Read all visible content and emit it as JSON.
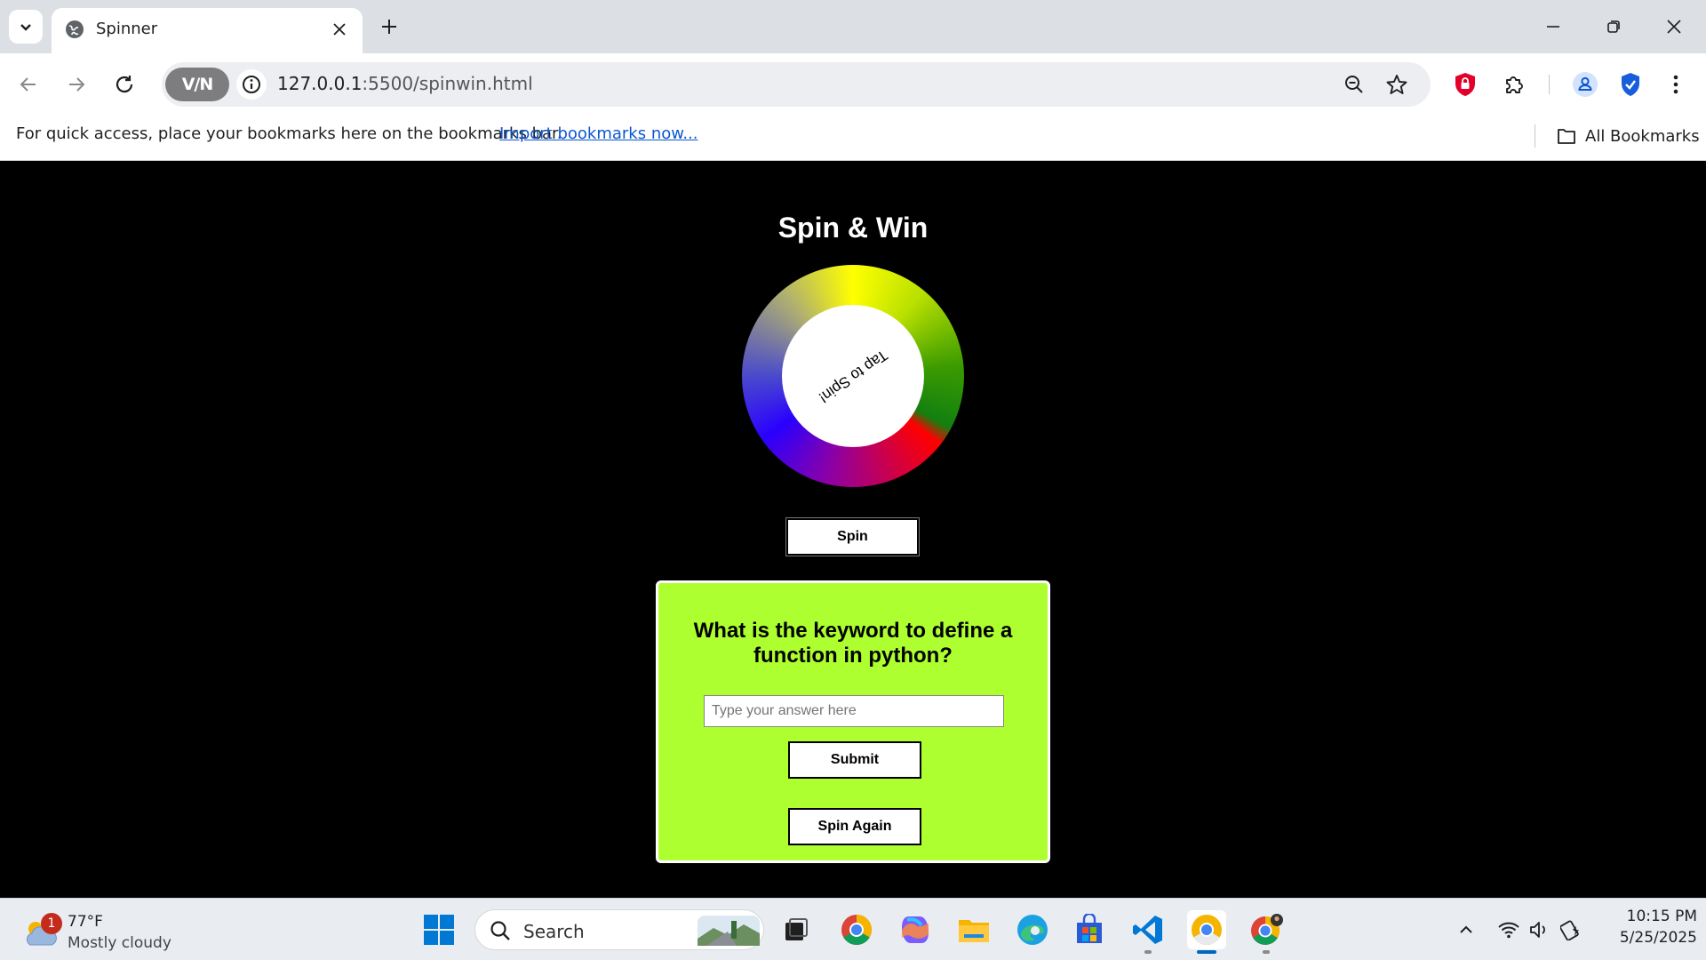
{
  "browser": {
    "tab": {
      "title": "Spinner"
    },
    "vpn_label": "V/N",
    "url": {
      "host": "127.0.0.1",
      "path": ":5500/spinwin.html"
    },
    "bookmarks": {
      "prompt": "For quick access, place your bookmarks here on the bookmarks bar.",
      "import_link": "Import bookmarks now...",
      "all_bookmarks": "All Bookmarks"
    }
  },
  "page": {
    "title": "Spin & Win",
    "wheel_center_label": "Tap to Spin!",
    "spin_button": "Spin",
    "quiz": {
      "question": "What is the keyword to define a function in python?",
      "answer_placeholder": "Type your answer here",
      "answer_value": "",
      "submit_button": "Submit",
      "spin_again_button": "Spin Again"
    },
    "colors": {
      "background": "#000000",
      "quiz_panel": "#adff2f",
      "title": "#ffffff"
    }
  },
  "taskbar": {
    "weather": {
      "badge": "1",
      "temperature": "77°F",
      "condition": "Mostly cloudy"
    },
    "search_label": "Search",
    "clock": {
      "time": "10:15 PM",
      "date": "5/25/2025"
    }
  }
}
